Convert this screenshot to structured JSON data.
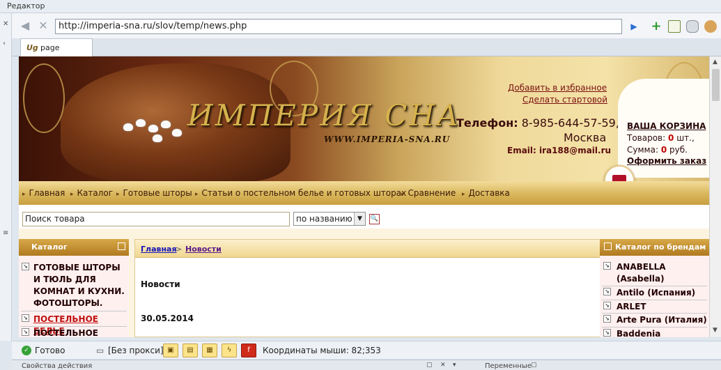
{
  "editor": {
    "title": "Редактор"
  },
  "toolbar": {
    "back_icon": "arrow-left-icon",
    "stop_icon": "close-icon",
    "address": "http://imperia-sna.ru/slov/temp/news.php",
    "go_icon": "play-icon",
    "icons": [
      "plus-icon",
      "notes-icon",
      "database-icon",
      "cookie-icon"
    ],
    "colors": {
      "plus": "#2f9a2f",
      "go": "#2b6fd0"
    }
  },
  "tab": {
    "label": "page",
    "icon_glyph": "Ug"
  },
  "site": {
    "brand": "ИМПЕРИЯ СНА",
    "brand_url": "WWW.IMPERIA-SNA.RU",
    "link_favorites": "Добавить в избранное",
    "link_start": "Сделать стартовой",
    "phone_label": "Телефон:",
    "phone_number": "8-985-644-57-59,",
    "city": "Москва",
    "email_label": "Email:",
    "email_value": "ira188@mail.ru",
    "cart": {
      "title": "ВАША КОРЗИНА",
      "items_label": "Товаров:",
      "items_value": "0",
      "items_unit": "шт.,",
      "sum_label": "Сумма:",
      "sum_value": "0",
      "sum_unit": "руб.",
      "order": "Оформить заказ"
    },
    "menu": [
      "Главная",
      "Каталог",
      "Готовые шторы",
      "Статьи о постельном белье и готовых шторах",
      "Сравнение",
      "Доставка"
    ],
    "search": {
      "value": "Поиск товара",
      "mode": "по названию",
      "button_glyph": "🔍"
    },
    "catalog": {
      "title": "Каталог",
      "items": [
        "ГОТОВЫЕ ШТОРЫ И ТЮЛЬ ДЛЯ КОМНАТ И КУХНИ. ФОТОШТОРЫ.",
        "ПОСТЕЛЬНОЕ БЕЛЬЕ",
        "ПОСТЕЛЬНОЕ БЕЛЬЕ"
      ]
    },
    "breadcrumb": {
      "home": "Главная",
      "separator": ">",
      "current": "Новости"
    },
    "news": {
      "title": "Новости",
      "date": "30.05.2014"
    },
    "brands": {
      "title": "Каталог по брендам",
      "items": [
        "ANABELLA (Asabella)",
        "Antilo (Испания)",
        "ARLET",
        "Arte Pura (Италия)",
        "Baddenia"
      ]
    }
  },
  "status": {
    "ready": "Готово",
    "proxy": "[Без прокси]",
    "mouse": "Координаты мыши: 82;353",
    "icons": [
      "image-icon",
      "window-icon",
      "frame-icon",
      "flash-icon",
      "flash-player-icon"
    ]
  },
  "panes": {
    "left": "Свойства действия",
    "right": "Переменные"
  }
}
